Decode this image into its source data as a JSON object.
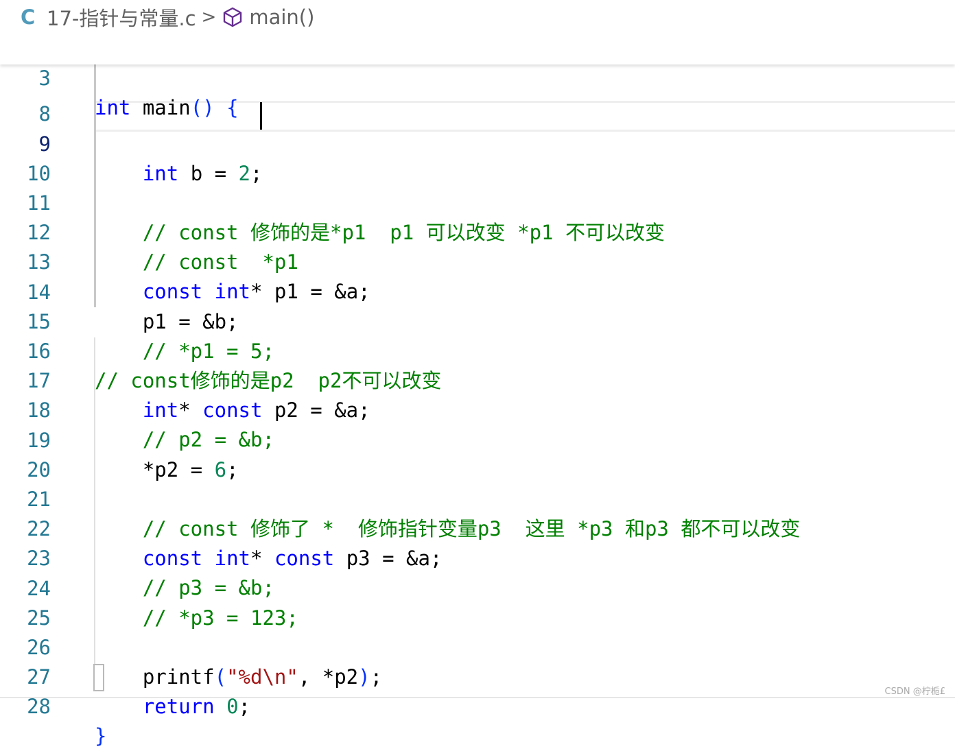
{
  "breadcrumb": {
    "lang_icon_text": "C",
    "file_name": "17-指针与常量.c",
    "separator": ">",
    "symbol_icon": "cube-icon",
    "symbol": "main()"
  },
  "sticky_line": {
    "number": "3",
    "kw": "int",
    "text": " main",
    "paren": "()",
    "brace": " {"
  },
  "lines": {
    "l8": {
      "number": "8"
    },
    "l9": {
      "number": "9",
      "indent": "    ",
      "kw": "int",
      "mid": " b = ",
      "num": "2",
      "end": ";"
    },
    "l10": {
      "number": "10"
    },
    "l11": {
      "number": "11",
      "indent": "    ",
      "comment": "// const 修饰的是*p1  p1 可以改变 *p1 不可以改变"
    },
    "l12": {
      "number": "12",
      "indent": "    ",
      "comment": "// const  *p1"
    },
    "l13": {
      "number": "13",
      "indent": "    ",
      "kw1": "const",
      "sp": " ",
      "kw2": "int",
      "rest": "* p1 = &a;"
    },
    "l14": {
      "number": "14",
      "indent": "    ",
      "text": "p1 = &b;"
    },
    "l15": {
      "number": "15",
      "indent": "    ",
      "comment": "// *p1 = 5;"
    },
    "l16": {
      "number": "16",
      "comment": "// const修饰的是p2  p2不可以改变"
    },
    "l17": {
      "number": "17",
      "indent": "    ",
      "kw1": "int",
      "mid": "* ",
      "kw2": "const",
      "rest": " p2 = &a;"
    },
    "l18": {
      "number": "18",
      "indent": "    ",
      "comment": "// p2 = &b;"
    },
    "l19": {
      "number": "19",
      "indent": "    ",
      "text": "*p2 = ",
      "num": "6",
      "end": ";"
    },
    "l20": {
      "number": "20"
    },
    "l21": {
      "number": "21",
      "indent": "    ",
      "comment": "// const 修饰了 *  修饰指针变量p3  这里 *p3 和p3 都不可以改变"
    },
    "l22": {
      "number": "22",
      "indent": "    ",
      "kw1": "const",
      "sp": " ",
      "kw2": "int",
      "mid": "* ",
      "kw3": "const",
      "rest": " p3 = &a;"
    },
    "l23": {
      "number": "23",
      "indent": "    ",
      "comment": "// p3 = &b;"
    },
    "l24": {
      "number": "24",
      "indent": "    ",
      "comment": "// *p3 = 123;"
    },
    "l25": {
      "number": "25"
    },
    "l26": {
      "number": "26",
      "indent": "    ",
      "fn": "printf",
      "open": "(",
      "str": "\"%d\\n\"",
      "mid": ", *p2",
      "close": ")",
      "end": ";"
    },
    "l27": {
      "number": "27",
      "indent": "    ",
      "kw": "return",
      "sp": " ",
      "num": "0",
      "end": ";"
    },
    "l28": {
      "number": "28",
      "brace": "}"
    }
  },
  "watermark": "CSDN @柠栀£"
}
